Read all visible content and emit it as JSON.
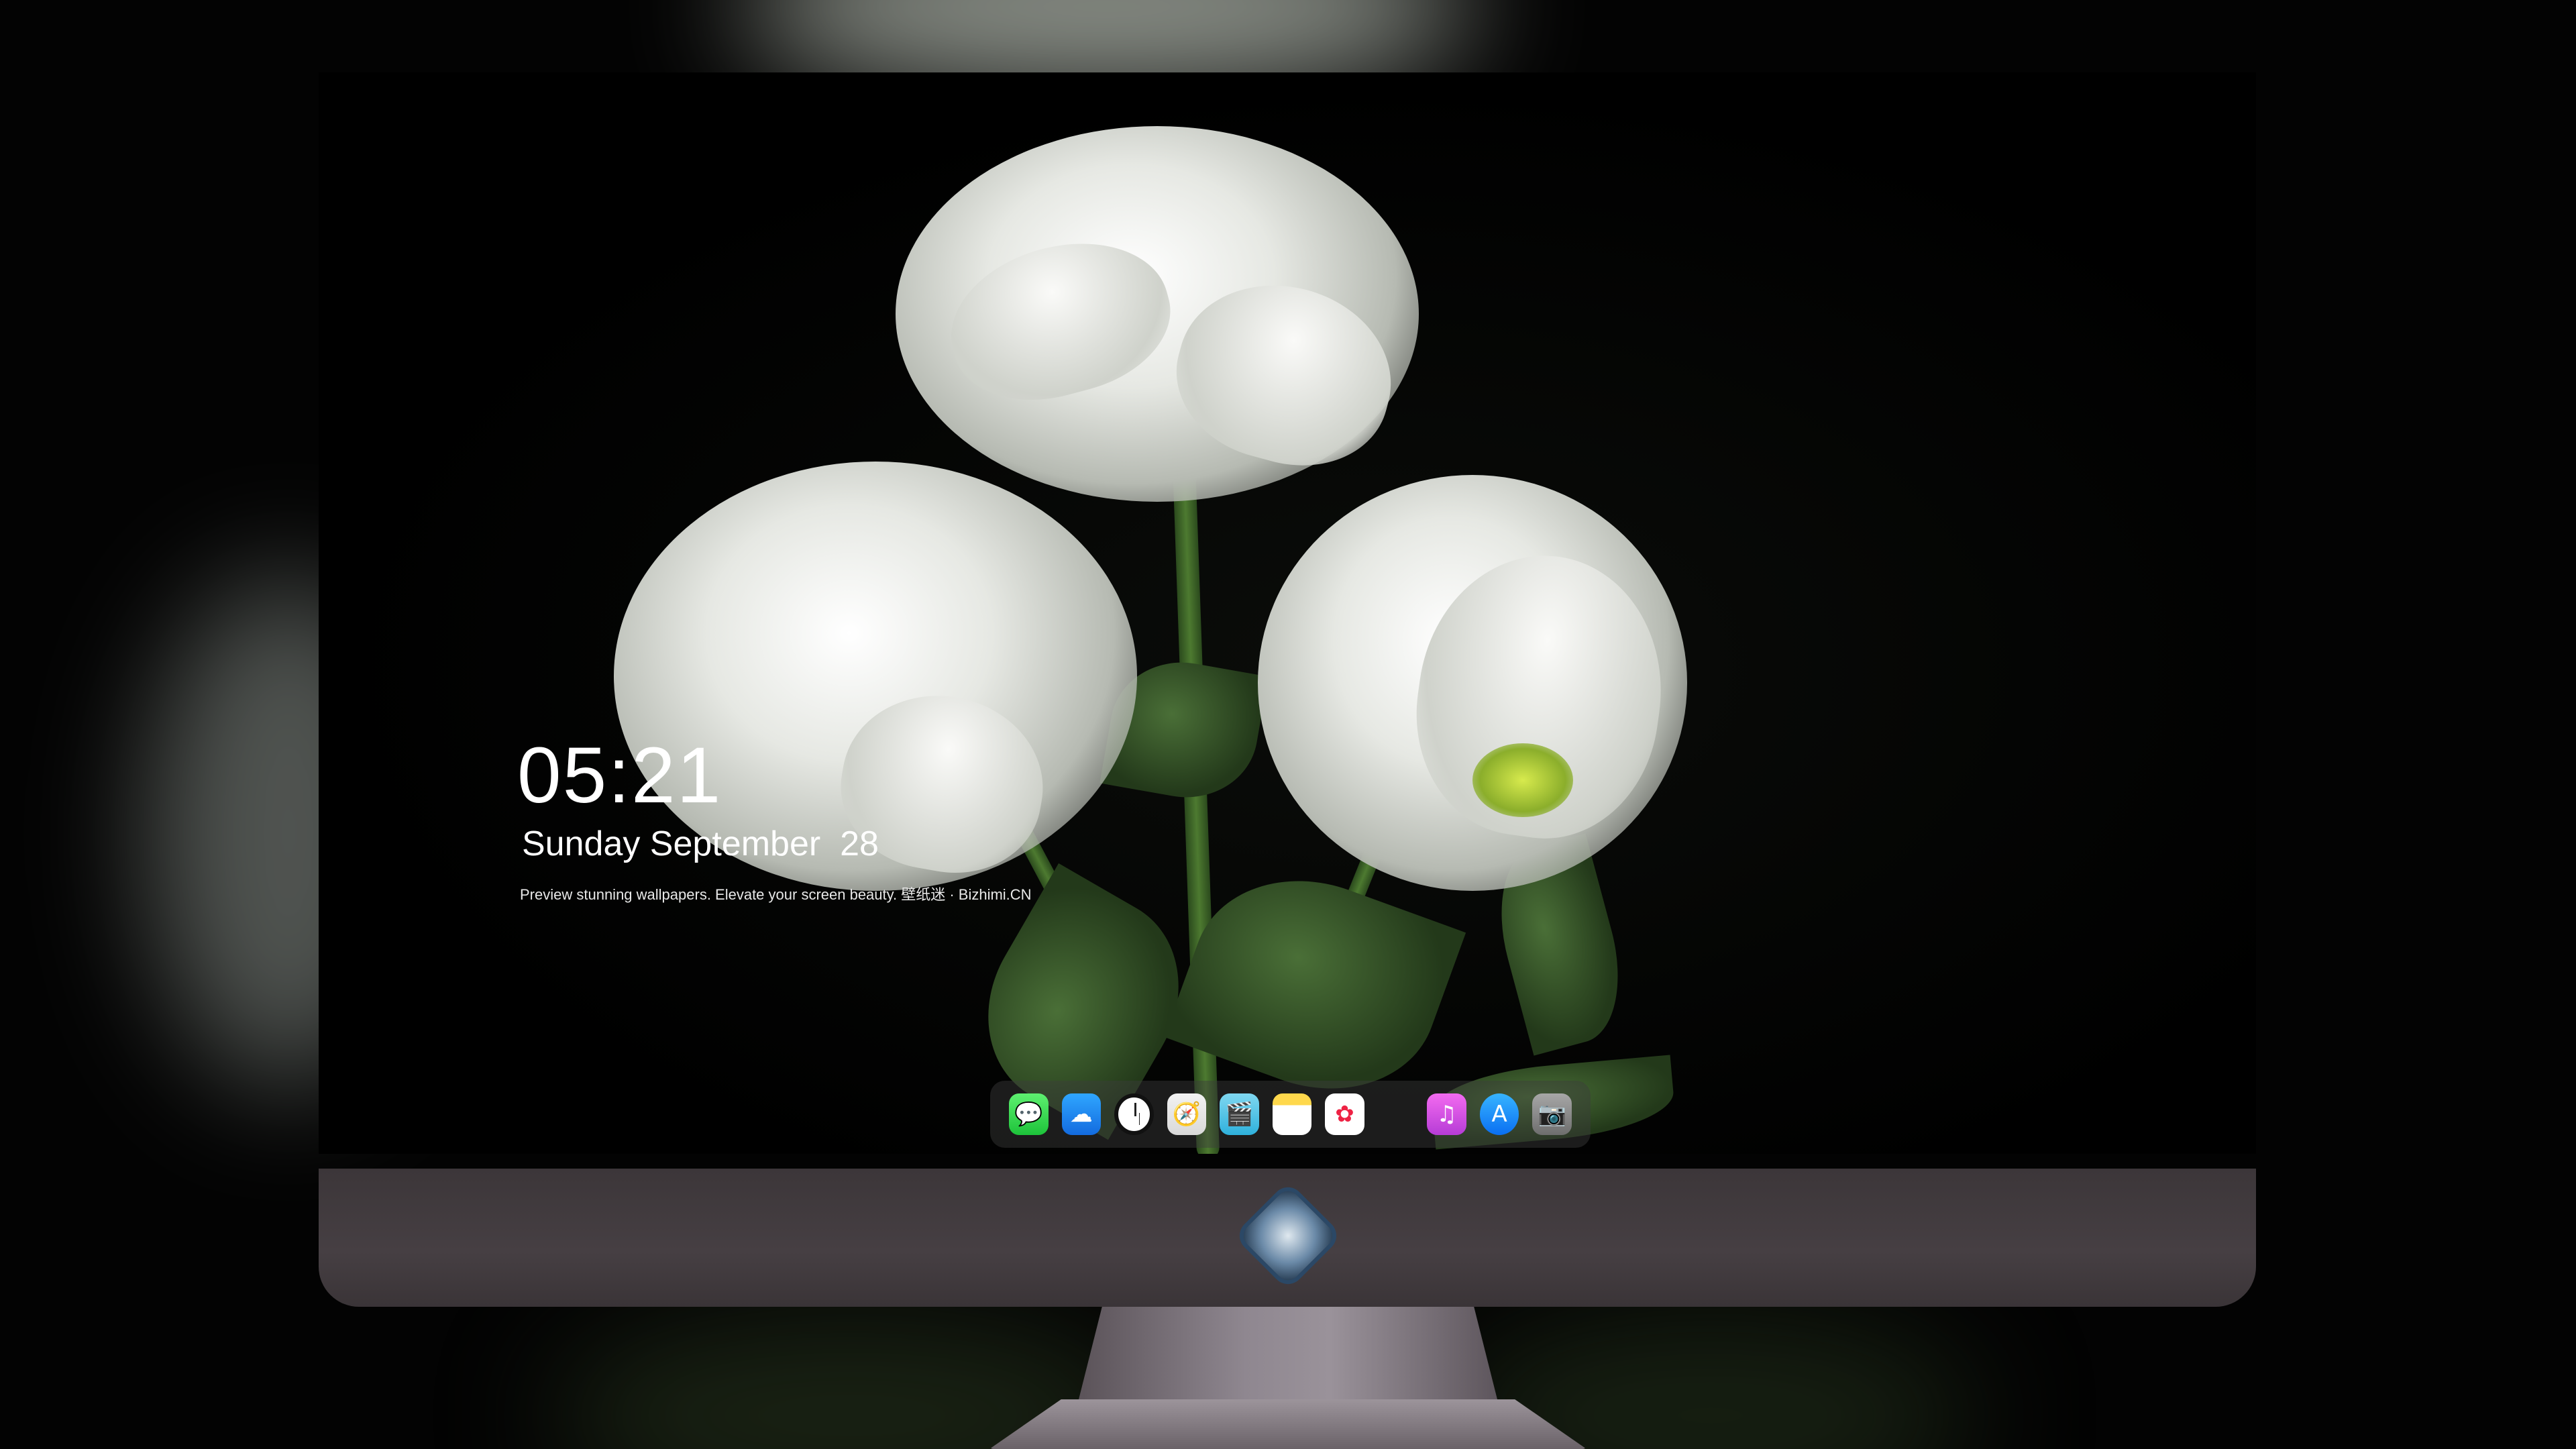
{
  "lock_screen": {
    "time": "05:21",
    "date": "Sunday September  28",
    "tagline": "Preview stunning wallpapers. Elevate your screen beauty. 壁纸迷 · Bizhimi.CN"
  },
  "dock": {
    "apps": [
      {
        "name": "messages-icon"
      },
      {
        "name": "weather-icon"
      },
      {
        "name": "clock-icon"
      },
      {
        "name": "safari-icon"
      },
      {
        "name": "video-icon"
      },
      {
        "name": "notes-icon"
      },
      {
        "name": "photos-icon"
      },
      {
        "name": "music-icon"
      },
      {
        "name": "app-store-icon"
      },
      {
        "name": "camera-icon"
      }
    ]
  },
  "colors": {
    "background": "#000000",
    "bezel": "#403a3e",
    "text": "#ffffff"
  }
}
